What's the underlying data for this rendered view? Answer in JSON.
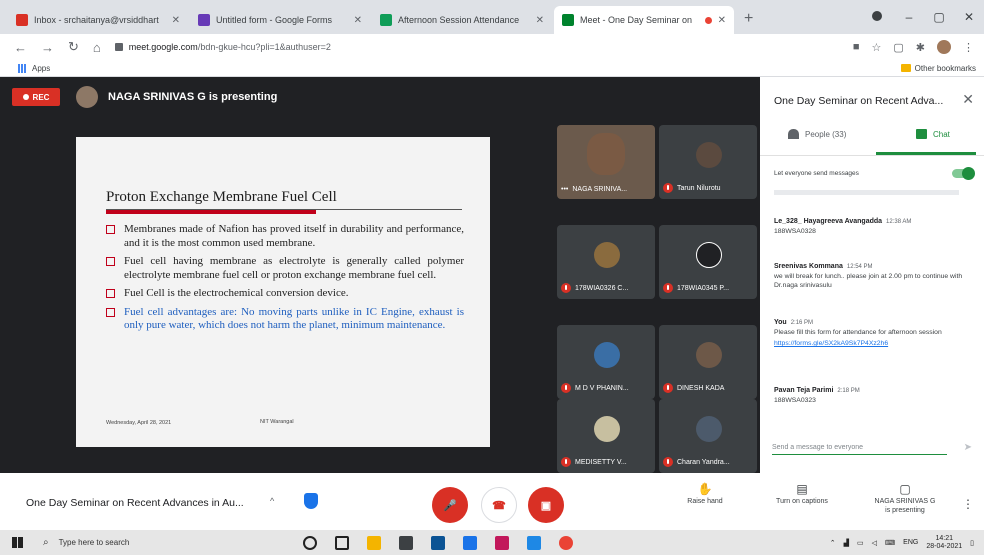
{
  "browser": {
    "tabs": [
      {
        "title": "Inbox - srchaitanya@vrsiddhart",
        "active": false,
        "color": "#d93025"
      },
      {
        "title": "Untitled form - Google Forms",
        "active": false,
        "color": "#673ab7"
      },
      {
        "title": "Afternoon Session Attendance",
        "active": false,
        "color": "#0f9d58"
      },
      {
        "title": "Meet - One Day Seminar on",
        "active": true,
        "color": "#00832d"
      }
    ],
    "url_host": "meet.google.com",
    "url_path": "/bdn-gkue-hcu?pli=1&authuser=2",
    "bookmarks_apps": "Apps",
    "other_bookmarks": "Other bookmarks"
  },
  "meeting": {
    "rec_label": "REC",
    "presenting_banner": "NAGA SRINIVAS G is presenting",
    "slide": {
      "title": "Proton Exchange Membrane Fuel Cell",
      "bullets": [
        {
          "text": "Membranes made of Nafion has proved itself in durability and performance, and it is the most common used membrane.",
          "blue": false
        },
        {
          "text": "Fuel cell having membrane as electrolyte is generally called polymer electrolyte membrane fuel cell or proton exchange membrane fuel cell.",
          "blue": false
        },
        {
          "text": "Fuel Cell is the electrochemical conversion device.",
          "blue": false
        },
        {
          "text": "Fuel cell advantages are: No moving parts unlike in IC Engine, exhaust is only pure water, which does not harm the planet, minimum maintenance.",
          "blue": true
        }
      ],
      "footer_date": "Wednesday, April 28, 2021",
      "footer_center": "NIT Warangal"
    },
    "participants": [
      {
        "name": "NAGA SRINIVA...",
        "muted": false,
        "video": true,
        "avatar": "#7a5a44"
      },
      {
        "name": "Tarun Nilurotu",
        "muted": true,
        "video": false,
        "avatar": "#5b4a3f"
      },
      {
        "name": "178WIA0326 C...",
        "muted": true,
        "video": false,
        "avatar": "#8a6b3e"
      },
      {
        "name": "178WIA0345 P...",
        "muted": true,
        "video": false,
        "avatar": "#202124"
      },
      {
        "name": "M D V PHANIN...",
        "muted": true,
        "video": false,
        "avatar": "#3a6ea5"
      },
      {
        "name": "DINESH KADA",
        "muted": true,
        "video": false,
        "avatar": "#6d5848"
      },
      {
        "name": "MEDISETTY V...",
        "muted": true,
        "video": false,
        "avatar": "#c7bfa0"
      },
      {
        "name": "Charan Yandra...",
        "muted": true,
        "video": false,
        "avatar": "#4c5a6b"
      }
    ]
  },
  "panel": {
    "title": "One Day Seminar on Recent Adva...",
    "people_tab": "People (33)",
    "chat_tab": "Chat",
    "everyone_label": "Let everyone send messages",
    "messages": [
      {
        "who": "Le_328_ Hayagreeva Avangadda",
        "time": "12:38 AM",
        "text": "188WSA0328",
        "link": ""
      },
      {
        "who": "Sreenivas Kommana",
        "time": "12:54 PM",
        "text": "we will break for lunch.. please join at 2.00 pm to continue with Dr.naga srinivasulu",
        "link": ""
      },
      {
        "who": "You",
        "time": "2:16 PM",
        "text": "Please fill this form for attendance for afternoon session",
        "link": "https://forms.gle/SX2kA9Sk7P4Xz2h6"
      },
      {
        "who": "Pavan Teja Parimi",
        "time": "2:18 PM",
        "text": "188WSA0323",
        "link": ""
      }
    ],
    "input_placeholder": "Send a message to everyone"
  },
  "bottombar": {
    "meeting_name": "One Day Seminar on Recent Advances in Au...",
    "raise_hand": "Raise hand",
    "captions": "Turn on captions",
    "presenting_1": "NAGA SRINIVAS G",
    "presenting_2": "is presenting"
  },
  "taskbar": {
    "search_placeholder": "Type here to search",
    "lang": "ENG",
    "time": "14:21",
    "date": "28-04-2021"
  }
}
